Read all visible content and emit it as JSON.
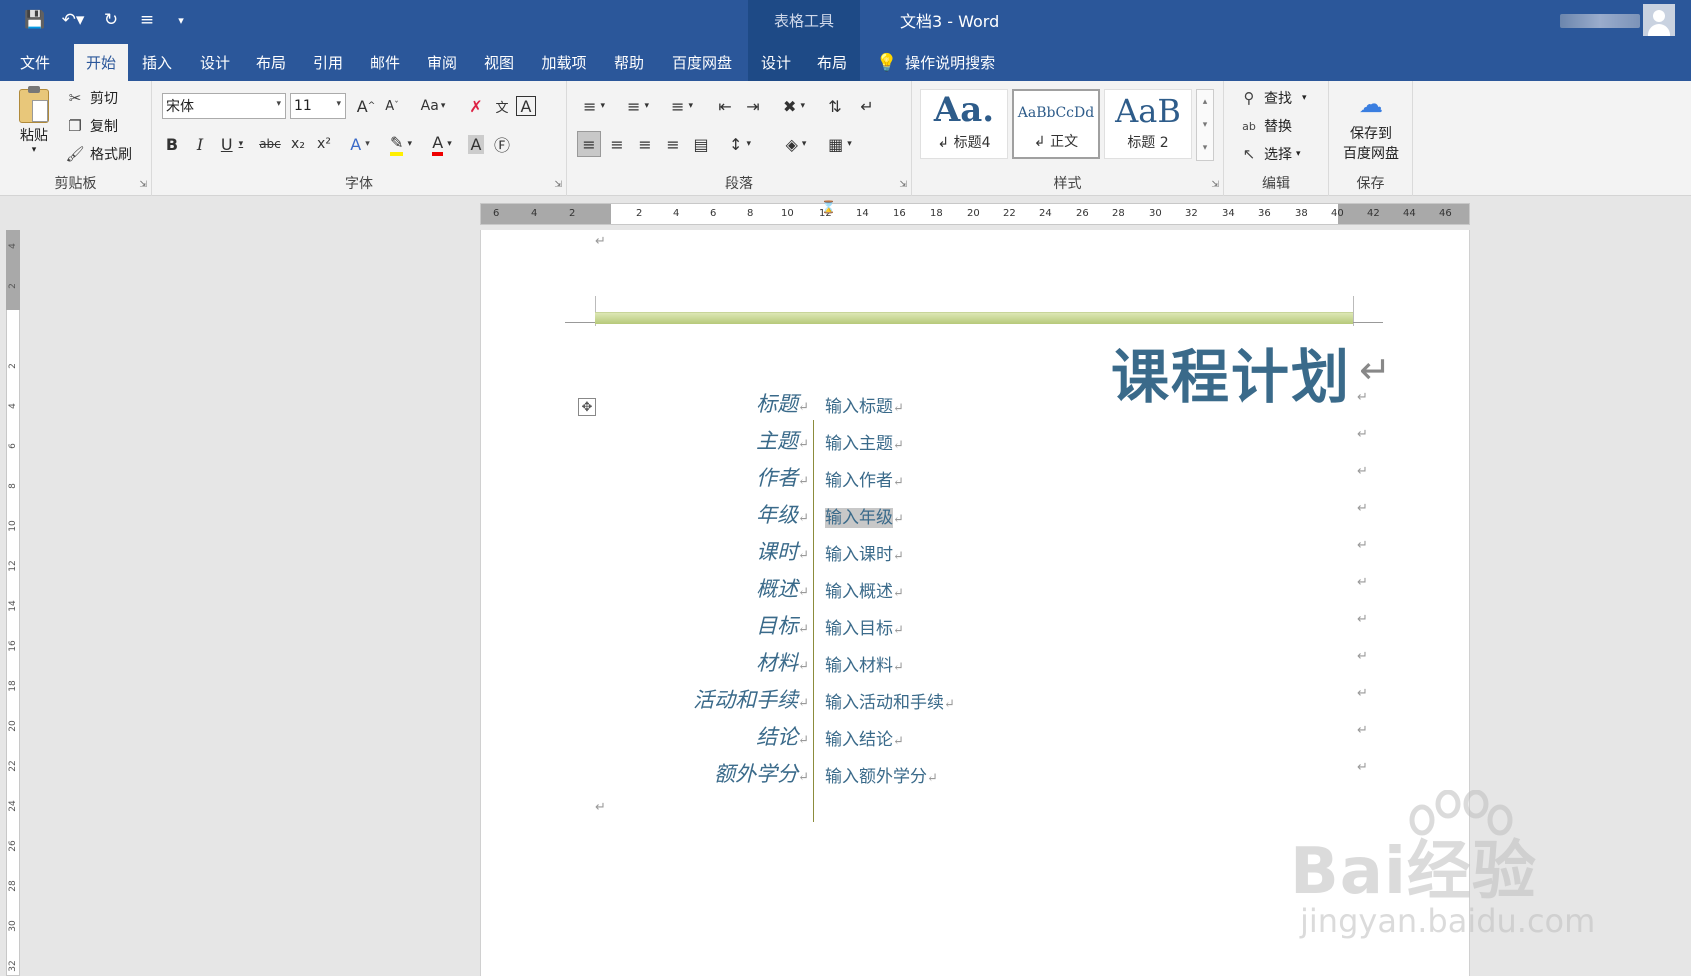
{
  "titlebar": {
    "contextual_tab": "表格工具",
    "doc_title": "文档3  -  Word",
    "accent": "#2b579a"
  },
  "tabs": [
    {
      "label": "文件"
    },
    {
      "label": "开始"
    },
    {
      "label": "插入"
    },
    {
      "label": "设计"
    },
    {
      "label": "布局"
    },
    {
      "label": "引用"
    },
    {
      "label": "邮件"
    },
    {
      "label": "审阅"
    },
    {
      "label": "视图"
    },
    {
      "label": "加载项"
    },
    {
      "label": "帮助"
    },
    {
      "label": "百度网盘"
    },
    {
      "label": "设计"
    },
    {
      "label": "布局"
    }
  ],
  "tell_me": "操作说明搜索",
  "ribbon": {
    "clipboard": {
      "paste": "粘贴",
      "cut": "剪切",
      "copy": "复制",
      "format_painter": "格式刷",
      "label": "剪贴板"
    },
    "font": {
      "name": "宋体",
      "size": "11",
      "grow": "A",
      "shrink": "A",
      "case": "Aa",
      "label": "字体",
      "bold": "B",
      "italic": "I",
      "underline": "U",
      "strike": "abc",
      "sub": "x₂",
      "sup": "x²"
    },
    "paragraph": {
      "label": "段落"
    },
    "styles": {
      "label": "样式",
      "cards": [
        {
          "sample": "Aa.",
          "name": "↲ 标题4"
        },
        {
          "sample": "AaBbCcDd",
          "name": "↲ 正文"
        },
        {
          "sample": "AaB",
          "name": "标题 2"
        }
      ]
    },
    "editing": {
      "find": "查找",
      "replace": "替换",
      "select": "选择",
      "label": "编辑"
    },
    "save": {
      "line1": "保存到",
      "line2": "百度网盘",
      "label": "保存"
    }
  },
  "ruler": {
    "h_left_ticks": [
      "6",
      "4",
      "2"
    ],
    "h_right_ticks": [
      "2",
      "4",
      "6",
      "8",
      "10",
      "12",
      "14",
      "16",
      "18",
      "20",
      "22",
      "24",
      "26",
      "28",
      "30",
      "32",
      "34",
      "36",
      "38",
      "40",
      "42",
      "44",
      "46"
    ],
    "v_ticks": [
      "4",
      "2",
      "2",
      "4",
      "6",
      "8",
      "10",
      "12",
      "14",
      "16",
      "18",
      "20",
      "22",
      "24",
      "26",
      "28",
      "30",
      "32"
    ]
  },
  "document": {
    "title": "课程计划",
    "rows": [
      {
        "label": "标题",
        "value": "输入标题"
      },
      {
        "label": "主题",
        "value": "输入主题"
      },
      {
        "label": "作者",
        "value": "输入作者"
      },
      {
        "label": "年级",
        "value": "输入年级"
      },
      {
        "label": "课时",
        "value": "输入课时"
      },
      {
        "label": "概述",
        "value": "输入概述"
      },
      {
        "label": "目标",
        "value": "输入目标"
      },
      {
        "label": "材料",
        "value": "输入材料"
      },
      {
        "label": "活动和手续",
        "value": "输入活动和手续"
      },
      {
        "label": "结论",
        "value": "输入结论"
      },
      {
        "label": "额外学分",
        "value": "输入额外学分"
      }
    ],
    "title_color": "#3a6a8a"
  },
  "watermark": {
    "text": "Bai经验",
    "url": "jingyan.baidu.com"
  }
}
